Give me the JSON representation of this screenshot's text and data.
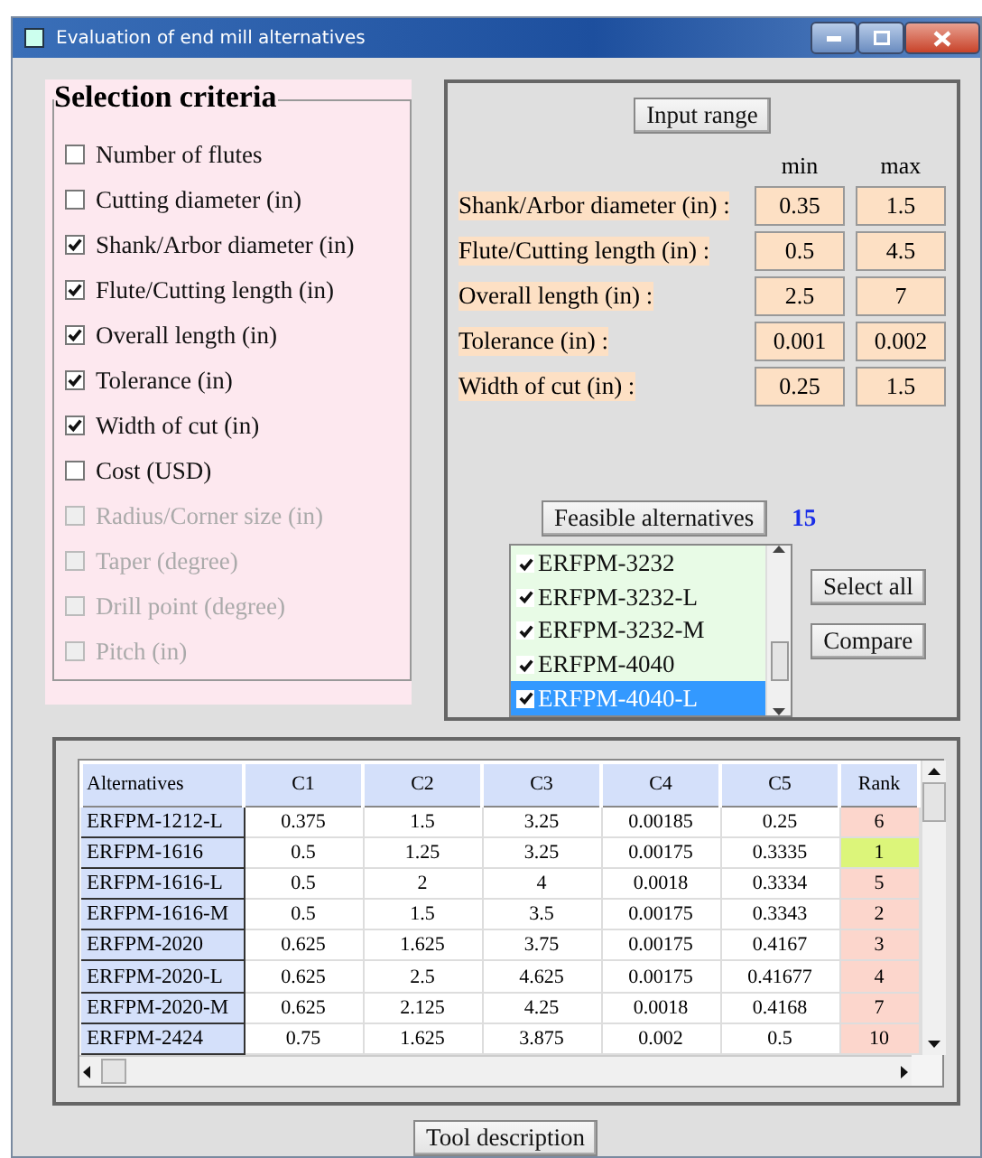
{
  "window": {
    "title": "Evaluation of end mill alternatives"
  },
  "criteria_title": "Selection criteria",
  "criteria": [
    {
      "label": "Number of flutes",
      "checked": false,
      "disabled": false
    },
    {
      "label": "Cutting diameter (in)",
      "checked": false,
      "disabled": false
    },
    {
      "label": "Shank/Arbor diameter (in)",
      "checked": true,
      "disabled": false
    },
    {
      "label": "Flute/Cutting length (in)",
      "checked": true,
      "disabled": false
    },
    {
      "label": "Overall length (in)",
      "checked": true,
      "disabled": false
    },
    {
      "label": "Tolerance (in)",
      "checked": true,
      "disabled": false
    },
    {
      "label": "Width of cut (in)",
      "checked": true,
      "disabled": false
    },
    {
      "label": "Cost (USD)",
      "checked": false,
      "disabled": false
    },
    {
      "label": "Radius/Corner size (in)",
      "checked": false,
      "disabled": true
    },
    {
      "label": "Taper (degree)",
      "checked": false,
      "disabled": true
    },
    {
      "label": "Drill point (degree)",
      "checked": false,
      "disabled": true
    },
    {
      "label": "Pitch (in)",
      "checked": false,
      "disabled": true
    }
  ],
  "input_range_button": "Input range",
  "range_headers": [
    "min",
    "max"
  ],
  "ranges": [
    {
      "label": "Shank/Arbor diameter (in) :",
      "min": "0.35",
      "max": "1.5"
    },
    {
      "label": "Flute/Cutting length (in) :",
      "min": "0.5",
      "max": "4.5"
    },
    {
      "label": "Overall length (in) :",
      "min": "2.5",
      "max": "7"
    },
    {
      "label": "Tolerance (in) :",
      "min": "0.001",
      "max": "0.002"
    },
    {
      "label": "Width of cut (in) :",
      "min": "0.25",
      "max": "1.5"
    }
  ],
  "feasible_button": "Feasible alternatives",
  "feasible_count": "15",
  "alternatives": [
    {
      "label": "ERFPM-3232",
      "checked": true,
      "selected": false
    },
    {
      "label": "ERFPM-3232-L",
      "checked": true,
      "selected": false
    },
    {
      "label": "ERFPM-3232-M",
      "checked": true,
      "selected": false
    },
    {
      "label": "ERFPM-4040",
      "checked": true,
      "selected": false
    },
    {
      "label": "ERFPM-4040-L",
      "checked": true,
      "selected": true
    }
  ],
  "select_all_button": "Select all",
  "compare_button": "Compare",
  "table": {
    "columns": [
      "Alternatives",
      "C1",
      "C2",
      "C3",
      "C4",
      "C5",
      "Rank"
    ],
    "rows": [
      {
        "cells": [
          "ERFPM-1212-L",
          "0.375",
          "1.5",
          "3.25",
          "0.00185",
          "0.25",
          "6"
        ],
        "best": false
      },
      {
        "cells": [
          "ERFPM-1616",
          "0.5",
          "1.25",
          "3.25",
          "0.00175",
          "0.3335",
          "1"
        ],
        "best": true
      },
      {
        "cells": [
          "ERFPM-1616-L",
          "0.5",
          "2",
          "4",
          "0.0018",
          "0.3334",
          "5"
        ],
        "best": false
      },
      {
        "cells": [
          "ERFPM-1616-M",
          "0.5",
          "1.5",
          "3.5",
          "0.00175",
          "0.3343",
          "2"
        ],
        "best": false
      },
      {
        "cells": [
          "ERFPM-2020",
          "0.625",
          "1.625",
          "3.75",
          "0.00175",
          "0.4167",
          "3"
        ],
        "best": false
      },
      {
        "cells": [
          "ERFPM-2020-L",
          "0.625",
          "2.5",
          "4.625",
          "0.00175",
          "0.41677",
          "4"
        ],
        "best": false
      },
      {
        "cells": [
          "ERFPM-2020-M",
          "0.625",
          "2.125",
          "4.25",
          "0.0018",
          "0.4168",
          "7"
        ],
        "best": false
      },
      {
        "cells": [
          "ERFPM-2424",
          "0.75",
          "1.625",
          "3.875",
          "0.002",
          "0.5",
          "10"
        ],
        "best": false
      }
    ]
  },
  "tool_description_button": "Tool description"
}
